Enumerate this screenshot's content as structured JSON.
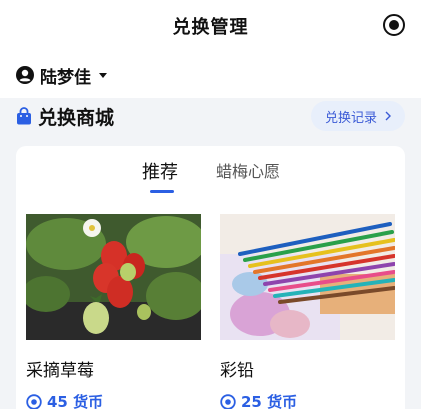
{
  "header": {
    "title": "兑换管理",
    "action_icon": "record-target-icon"
  },
  "user": {
    "name": "陆梦佳",
    "icon": "user-circle-icon"
  },
  "shop": {
    "title": "兑换商城",
    "icon": "shopping-bag-icon",
    "records_label": "兑换记录",
    "accent": "#2b5fe3"
  },
  "tabs": [
    {
      "label": "推荐",
      "active": true
    },
    {
      "label": "蜡梅心愿",
      "active": false
    }
  ],
  "products": [
    {
      "name": "采摘草莓",
      "price": "45 货币",
      "image": "strawberries-photo"
    },
    {
      "name": "彩铅",
      "price": "25 货币",
      "image": "colored-pencils-photo"
    }
  ]
}
